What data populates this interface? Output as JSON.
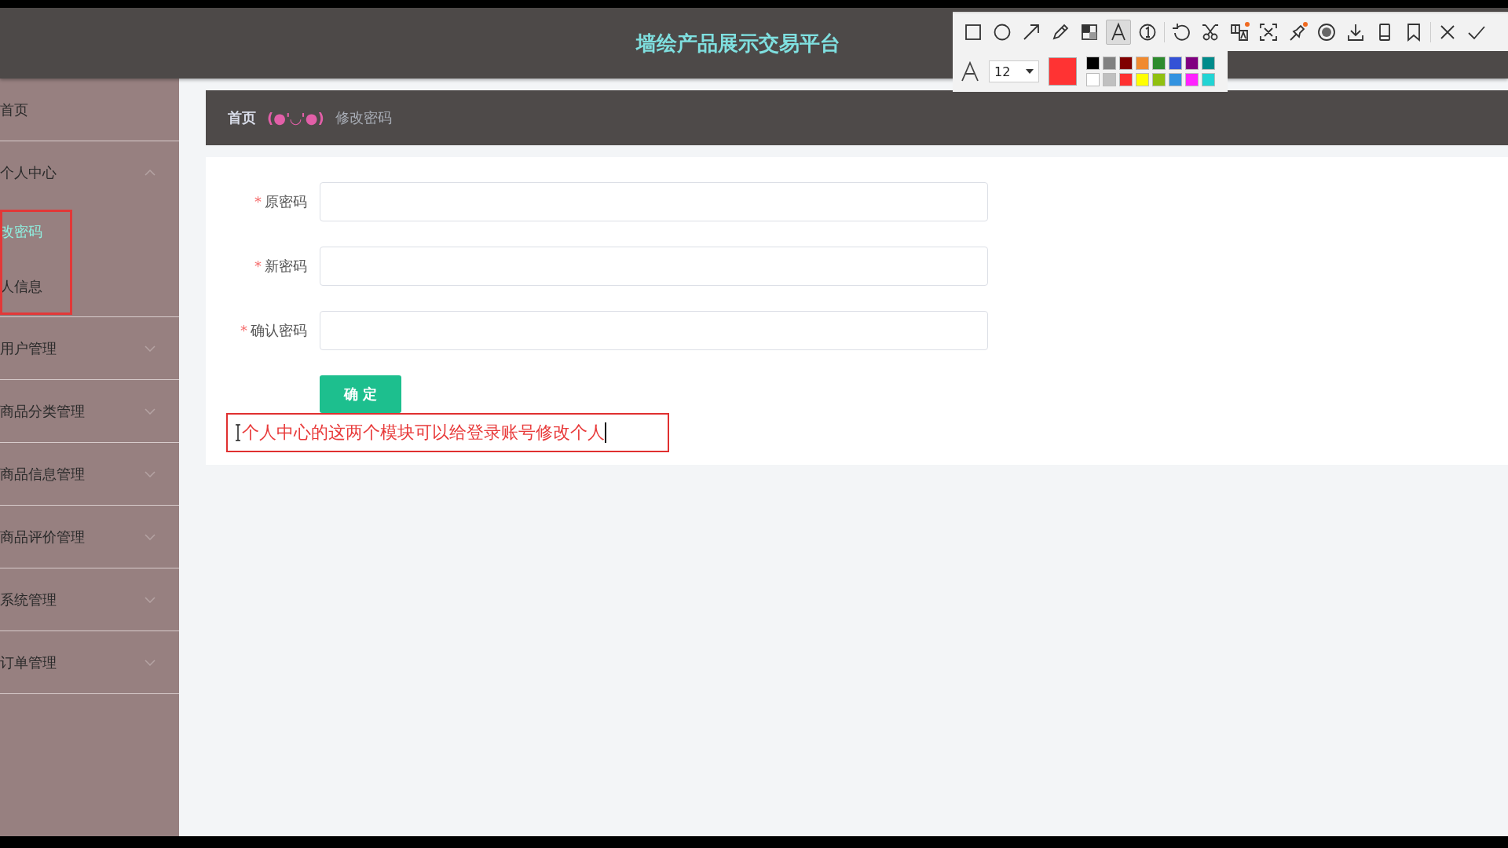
{
  "header": {
    "title": "墙绘产品展示交易平台"
  },
  "sidebar": {
    "items": [
      {
        "kind": "link",
        "label": "首页"
      },
      {
        "kind": "menu",
        "label": "个人中心",
        "expanded": true,
        "children": [
          {
            "label": "改密码",
            "selected": true
          },
          {
            "label": "人信息",
            "selected": false
          }
        ]
      },
      {
        "kind": "menu",
        "label": "用户管理",
        "expanded": false
      },
      {
        "kind": "menu",
        "label": "商品分类管理",
        "expanded": false
      },
      {
        "kind": "menu",
        "label": "商品信息管理",
        "expanded": false
      },
      {
        "kind": "menu",
        "label": "商品评价管理",
        "expanded": false
      },
      {
        "kind": "menu",
        "label": "系统管理",
        "expanded": false
      },
      {
        "kind": "menu",
        "label": "订单管理",
        "expanded": false
      }
    ]
  },
  "breadcrumb": {
    "home": "首页",
    "separator": "(●'◡'●)",
    "current": "修改密码"
  },
  "form": {
    "fields": [
      {
        "label": "原密码",
        "required_mark": "*"
      },
      {
        "label": "新密码",
        "required_mark": "*"
      },
      {
        "label": "确认密码",
        "required_mark": "*"
      }
    ],
    "submit": "确 定"
  },
  "annotation": {
    "text": "个人中心的这两个模块可以给登录账号修改个人"
  },
  "screenshot_toolbar": {
    "tools": [
      {
        "kind": "rectangle",
        "selected": false
      },
      {
        "kind": "ellipse",
        "selected": false
      },
      {
        "kind": "arrow",
        "selected": false
      },
      {
        "kind": "pencil",
        "selected": false
      },
      {
        "kind": "mosaic",
        "selected": false
      },
      {
        "kind": "text",
        "selected": true
      },
      {
        "kind": "number",
        "selected": false
      },
      {
        "kind": "undo",
        "selected": false
      },
      {
        "kind": "cut",
        "selected": false
      },
      {
        "kind": "translate",
        "selected": false
      },
      {
        "kind": "ocr",
        "selected": false
      },
      {
        "kind": "pin",
        "selected": false
      },
      {
        "kind": "record",
        "selected": false
      },
      {
        "kind": "download",
        "selected": false
      },
      {
        "kind": "phone",
        "selected": false
      },
      {
        "kind": "bookmark",
        "selected": false
      }
    ],
    "actions": [
      {
        "kind": "close"
      },
      {
        "kind": "confirm"
      }
    ],
    "font_size": "12",
    "current": {
      "color": "#ff3333"
    },
    "palette": [
      {
        "color": "#000000"
      },
      {
        "color": "#808080"
      },
      {
        "color": "#800000"
      },
      {
        "color": "#f08a30"
      },
      {
        "color": "#2e8b2e"
      },
      {
        "color": "#3452d6"
      },
      {
        "color": "#800080"
      },
      {
        "color": "#008b8b"
      },
      {
        "color": "#ffffff"
      },
      {
        "color": "#c0c0c0"
      },
      {
        "color": "#ff3030"
      },
      {
        "color": "#ffff00"
      },
      {
        "color": "#90c010"
      },
      {
        "color": "#3393e0"
      },
      {
        "color": "#ff22ff"
      },
      {
        "color": "#22d4d4"
      }
    ]
  }
}
